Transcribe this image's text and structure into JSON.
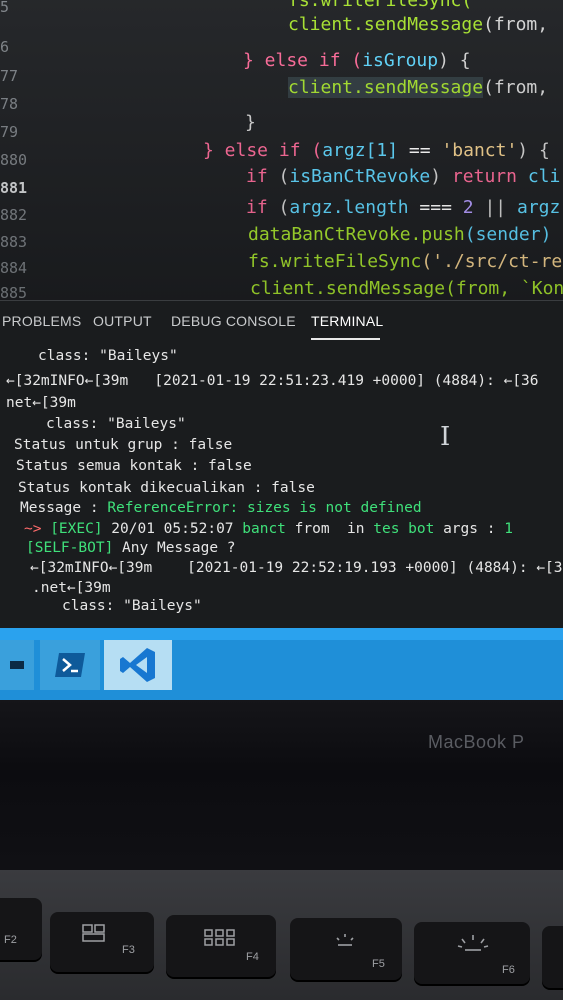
{
  "editor": {
    "line_numbers": [
      "5",
      "6",
      "77",
      "78",
      "79",
      "880",
      "881",
      "882",
      "883",
      "884",
      "885"
    ],
    "code": {
      "l0": "fs.writeFileSync(",
      "l1_fn": "client.sendMessage",
      "l1_rest": "(from,",
      "l2_a": "} else if (",
      "l2_var": "isGroup",
      "l2_b": ") {",
      "l3_fn": "client.sendMessage",
      "l3_rest": "(from,",
      "l4": "}",
      "l5_a": "} else if (",
      "l5_var": "argz[1]",
      "l5_op": " == ",
      "l5_str": "'banct'",
      "l5_b": ") {",
      "l6_kw": "if",
      "l6_a": " (",
      "l6_var": "isBanCtRevoke",
      "l6_b": ") ",
      "l6_kw2": "return",
      "l6_c": " cli",
      "l7_kw": "if",
      "l7_a": " (",
      "l7_var": "argz.length",
      "l7_op": " === ",
      "l7_num": "2",
      "l7_b": " || ",
      "l7_var2": "argz",
      "l8_fn": "dataBanCtRevoke.push",
      "l8_rest": "(sender)",
      "l9_fn": "fs.writeFileSync",
      "l9_rest": "('./src/ct-re",
      "l10": "client.sendMessage(from, `Kon"
    }
  },
  "panel": {
    "tabs": [
      "PROBLEMS",
      "OUTPUT",
      "DEBUG CONSOLE",
      "TERMINAL"
    ],
    "active_tab": "TERMINAL",
    "terminal": {
      "t1": "class: \"Baileys\"",
      "t2": "←[32mINFO←[39m   [2021-01-19 22:51:23.419 +0000] (4884): ←[36",
      "t3": "net←[39m",
      "t4": "class: \"Baileys\"",
      "t5": "Status untuk grup : false",
      "t6": "Status semua kontak : false",
      "t7": "Status kontak dikecualikan : false",
      "t8_a": "Message : ",
      "t8_b": "ReferenceError: sizes is not defined",
      "t9_arrow": "~>",
      "t9_a": " [EXEC]",
      "t9_b": " 20/01 05:52:07 ",
      "t9_c": "banct",
      "t9_d": " from ",
      "t9_e": " in ",
      "t9_f": "tes bot",
      "t9_g": " args : ",
      "t9_h": "1",
      "t10_a": "[SELF-BOT]",
      "t10_b": " Any Message ?",
      "t11": "←[32mINFO←[39m    [2021-01-19 22:52:19.193 +0000] (4884): ←[36mc",
      "t12": ".net←[39m",
      "t13": "class: \"Baileys\""
    }
  },
  "laptop": {
    "brand": "MacBook P",
    "keys": [
      "F2",
      "F3",
      "F4",
      "F5",
      "F6"
    ]
  },
  "colors": {
    "editor_bg": "#1d1f22",
    "keyword": "#ff6b9a",
    "function": "#a6e22e",
    "variable": "#5fd7ff",
    "string": "#f2d08f",
    "terminal_green": "#3fe07a",
    "taskbar": "#1f8fd8"
  }
}
